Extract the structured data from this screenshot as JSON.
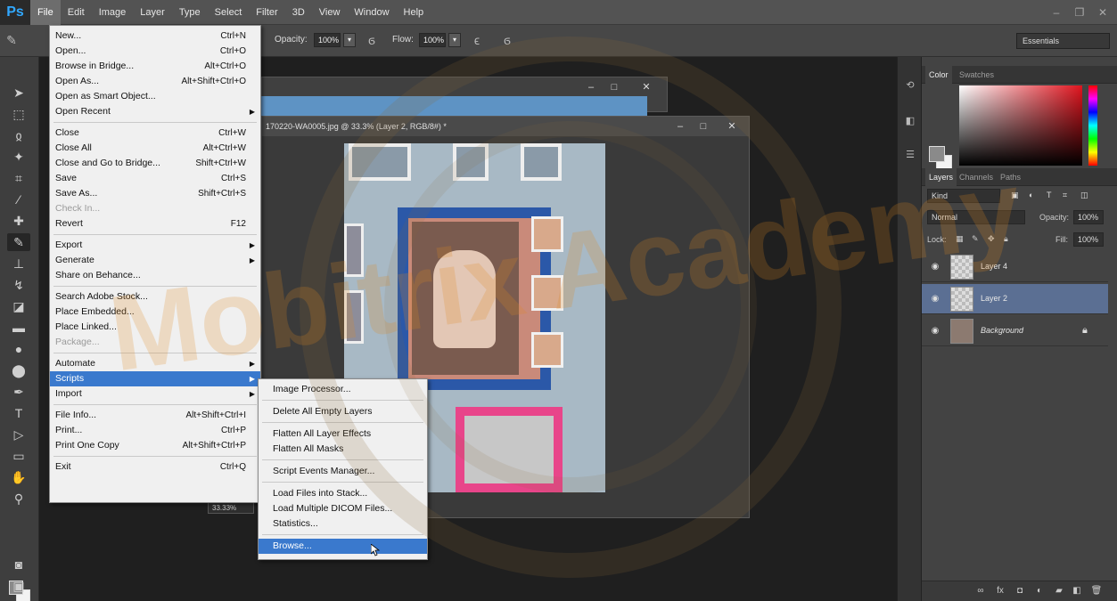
{
  "app": {
    "logo": "Ps",
    "menus": [
      "File",
      "Edit",
      "Image",
      "Layer",
      "Type",
      "Select",
      "Filter",
      "3D",
      "View",
      "Window",
      "Help"
    ],
    "active_menu": "File"
  },
  "options_bar": {
    "opacity_label": "Opacity:",
    "opacity_value": "100%",
    "flow_label": "Flow:",
    "flow_value": "100%",
    "workspace": "Essentials"
  },
  "document": {
    "title": "170220-WA0005.jpg @ 33.3% (Layer 2, RGB/8#) *",
    "zoom": "33.33%"
  },
  "file_menu": {
    "items": [
      {
        "label": "New...",
        "shortcut": "Ctrl+N"
      },
      {
        "label": "Open...",
        "shortcut": "Ctrl+O"
      },
      {
        "label": "Browse in Bridge...",
        "shortcut": "Alt+Ctrl+O"
      },
      {
        "label": "Open As...",
        "shortcut": "Alt+Shift+Ctrl+O"
      },
      {
        "label": "Open as Smart Object...",
        "shortcut": ""
      },
      {
        "label": "Open Recent",
        "shortcut": "",
        "submenu": true
      },
      {
        "label": "Close",
        "shortcut": "Ctrl+W"
      },
      {
        "label": "Close All",
        "shortcut": "Alt+Ctrl+W"
      },
      {
        "label": "Close and Go to Bridge...",
        "shortcut": "Shift+Ctrl+W"
      },
      {
        "label": "Save",
        "shortcut": "Ctrl+S"
      },
      {
        "label": "Save As...",
        "shortcut": "Shift+Ctrl+S"
      },
      {
        "label": "Check In...",
        "shortcut": "",
        "disabled": true
      },
      {
        "label": "Revert",
        "shortcut": "F12"
      },
      {
        "label": "Export",
        "shortcut": "",
        "submenu": true
      },
      {
        "label": "Generate",
        "shortcut": "",
        "submenu": true
      },
      {
        "label": "Share on Behance...",
        "shortcut": ""
      },
      {
        "label": "Search Adobe Stock...",
        "shortcut": ""
      },
      {
        "label": "Place Embedded...",
        "shortcut": ""
      },
      {
        "label": "Place Linked...",
        "shortcut": ""
      },
      {
        "label": "Package...",
        "shortcut": "",
        "disabled": true
      },
      {
        "label": "Automate",
        "shortcut": "",
        "submenu": true
      },
      {
        "label": "Scripts",
        "shortcut": "",
        "submenu": true,
        "highlight": true
      },
      {
        "label": "Import",
        "shortcut": "",
        "submenu": true
      },
      {
        "label": "File Info...",
        "shortcut": "Alt+Shift+Ctrl+I"
      },
      {
        "label": "Print...",
        "shortcut": "Ctrl+P"
      },
      {
        "label": "Print One Copy",
        "shortcut": "Alt+Shift+Ctrl+P"
      },
      {
        "label": "Exit",
        "shortcut": "Ctrl+Q"
      }
    ]
  },
  "scripts_menu": {
    "items": [
      {
        "label": "Image Processor..."
      },
      {
        "label": "Delete All Empty Layers"
      },
      {
        "label": "Flatten All Layer Effects"
      },
      {
        "label": "Flatten All Masks"
      },
      {
        "label": "Script Events Manager..."
      },
      {
        "label": "Load Files into Stack..."
      },
      {
        "label": "Load Multiple DICOM Files..."
      },
      {
        "label": "Statistics..."
      },
      {
        "label": "Browse...",
        "highlight": true
      }
    ]
  },
  "color_panel": {
    "tabs": [
      "Color",
      "Swatches"
    ]
  },
  "layers_panel": {
    "tabs": [
      "Layers",
      "Channels",
      "Paths"
    ],
    "kind_filter": "Kind",
    "blend_mode": "Normal",
    "opacity_label": "Opacity:",
    "opacity_value": "100%",
    "lock_label": "Lock:",
    "fill_label": "Fill:",
    "fill_value": "100%",
    "layers": [
      {
        "name": "Layer 4",
        "selected": false
      },
      {
        "name": "Layer 2",
        "selected": true
      },
      {
        "name": "Background",
        "selected": false,
        "locked": true
      }
    ]
  },
  "watermark": {
    "text": "Mobitrix Academy",
    "color": "#e08a1e"
  },
  "colors": {
    "menu_highlight": "#3a79cd",
    "selected_layer": "#5b6f93",
    "ps_blue": "#31a8ff"
  }
}
